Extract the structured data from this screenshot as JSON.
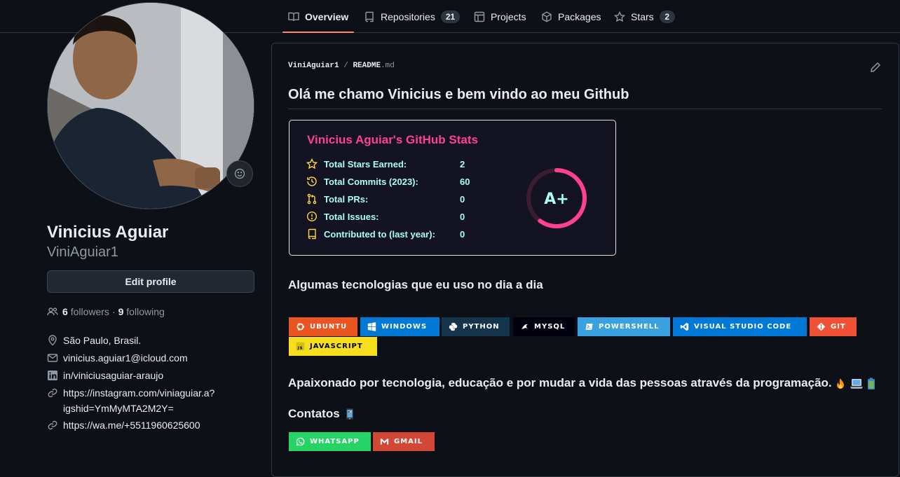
{
  "nav": {
    "tabs": [
      {
        "label": "Overview",
        "icon": "book-icon"
      },
      {
        "label": "Repositories",
        "count": "21",
        "icon": "repo-icon"
      },
      {
        "label": "Projects",
        "icon": "table-icon"
      },
      {
        "label": "Packages",
        "icon": "package-icon"
      },
      {
        "label": "Stars",
        "count": "2",
        "icon": "star-icon"
      }
    ],
    "active": "Overview",
    "accent": "#fd8c73"
  },
  "profile": {
    "name": "Vinicius Aguiar",
    "username": "ViniAguiar1",
    "edit_label": "Edit profile",
    "followers_count": "6",
    "followers_label": "followers",
    "separator": "·",
    "following_count": "9",
    "following_label": "following",
    "location": "São Paulo, Brasil.",
    "email": "vinicius.aguiar1@icloud.com",
    "linkedin": "in/viniciusaguiar-araujo",
    "link1_line1": "https://instagram.com/viniaguiar.a?",
    "link1_line2": "igshid=YmMyMTA2M2Y=",
    "link2": "https://wa.me/+5511960625600"
  },
  "readme": {
    "owner": "ViniAguiar1",
    "slash": "/",
    "file_base": "README",
    "file_ext": ".md",
    "heading": "Olá me chamo Vinicius e bem vindo ao meu Github",
    "stats_card": {
      "title": "Vinicius Aguiar's GitHub Stats",
      "rows": [
        {
          "label": "Total Stars Earned:",
          "value": "2",
          "icon": "star-icon"
        },
        {
          "label": "Total Commits (2023):",
          "value": "60",
          "icon": "history-icon"
        },
        {
          "label": "Total PRs:",
          "value": "0",
          "icon": "pull-request-icon"
        },
        {
          "label": "Total Issues:",
          "value": "0",
          "icon": "issue-icon"
        },
        {
          "label": "Contributed to (last year):",
          "value": "0",
          "icon": "repo-icon"
        }
      ],
      "rank": "A+",
      "rank_progress": 0.6,
      "colors": {
        "title": "#fe428e",
        "text": "#a9fef7",
        "icon": "#f8d847",
        "bg": "#141321",
        "ring": "#fe428e"
      }
    },
    "tech_heading": "Algumas tecnologias que eu uso no dia a dia",
    "tech_badges": [
      {
        "label": "UBUNTU",
        "color": "#e95420",
        "icon": "ubuntu-icon"
      },
      {
        "label": "WINDOWS",
        "color": "#0078d6",
        "icon": "windows-icon"
      },
      {
        "label": "PYTHON",
        "color": "#14354c",
        "icon": "python-icon"
      },
      {
        "label": "MYSQL",
        "color": "#00000f",
        "icon": "mysql-icon"
      },
      {
        "label": "POWERSHELL",
        "color": "#5391fe",
        "icon": "powershell-icon"
      },
      {
        "label": "VISUAL STUDIO CODE",
        "color": "#0078d7",
        "icon": "vscode-icon"
      },
      {
        "label": "GIT",
        "color": "#f05033",
        "icon": "git-icon"
      },
      {
        "label": "JAVASCRIPT",
        "color": "#f7df1e",
        "icon": "javascript-icon"
      }
    ],
    "paragraph": "Apaixonado por tecnologia, educação e por mudar a vida das pessoas através da programação.",
    "paragraph_emojis": [
      "fire-emoji",
      "laptop-emoji",
      "battery-emoji"
    ],
    "contacts_heading": "Contatos",
    "contact_badges": [
      {
        "label": "WHATSAPP",
        "color": "#25d366",
        "icon": "whatsapp-icon"
      },
      {
        "label": "GMAIL",
        "color": "#d14836",
        "icon": "gmail-icon"
      }
    ]
  }
}
